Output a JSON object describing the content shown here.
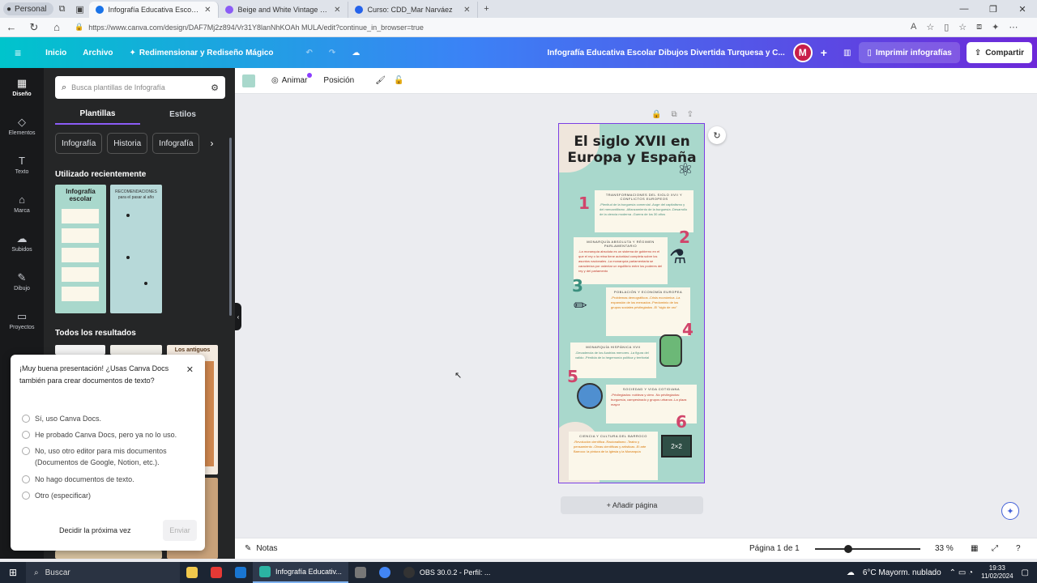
{
  "browser": {
    "profile": "Personal",
    "tabs": [
      {
        "title": "Infografía Educativa Escolar Dibuj...",
        "color": "#1a73e8"
      },
      {
        "title": "Beige and White Vintage Histori...",
        "color": "#8b5cf6"
      },
      {
        "title": "Curso: CDD_Mar Narváez",
        "color": "#2563eb"
      }
    ],
    "url": "https://www.canva.com/design/DAF7Mj2z894/Vr31Y8lanNhKOAh MULA/edit?continue_in_browser=true"
  },
  "header": {
    "home": "Inicio",
    "file": "Archivo",
    "resize": "Redimensionar y Rediseño Mágico",
    "doc_title": "Infografía Educativa Escolar Dibujos Divertida Turquesa y C...",
    "avatar": "M",
    "print": "Imprimir infografías",
    "share": "Compartir"
  },
  "rail": [
    {
      "label": "Diseño",
      "icon": "design-icon"
    },
    {
      "label": "Elementos",
      "icon": "elements-icon"
    },
    {
      "label": "Texto",
      "icon": "text-icon"
    },
    {
      "label": "Marca",
      "icon": "brand-icon"
    },
    {
      "label": "Subidos",
      "icon": "upload-icon"
    },
    {
      "label": "Dibujo",
      "icon": "draw-icon"
    },
    {
      "label": "Proyectos",
      "icon": "projects-icon"
    }
  ],
  "panel": {
    "search_placeholder": "Busca plantillas de Infografía",
    "tabs": [
      "Plantillas",
      "Estilos"
    ],
    "chips": [
      "Infografía",
      "Historia",
      "Infografía"
    ],
    "recent_title": "Utilizado recientemente",
    "all_title": "Todos los resultados",
    "thumb1_title": "Infografía escolar",
    "thumb2_title": "RECOMENDACIONES para el pasar al año",
    "thumb3_title": "Los antiguos"
  },
  "survey": {
    "question": "¡Muy buena presentación! ¿Usas Canva Docs también para crear documentos de texto?",
    "options": [
      "Sí, uso Canva Docs.",
      "He probado Canva Docs, pero ya no lo uso.",
      "No, uso otro editor para mis documentos (Documentos de Google, Notion, etc.).",
      "No hago documentos de texto.",
      "Otro (especificar)"
    ],
    "later": "Decidir la próxima vez",
    "send": "Enviar"
  },
  "toolbar": {
    "animate": "Animar",
    "position": "Posición"
  },
  "infographic": {
    "title": "El siglo XVII en Europa y España",
    "sections": [
      {
        "n": "1",
        "heading": "TRANSFORMACIONES DEL SIGLO XVII Y CONFLICTOS EUROPEOS",
        "lines": "-Plenitud de la burguesía comercial -Auge del capitalismo y del mercantilismo -Afianzamiento de la burguesía -Desarrollo de la ciencia moderna -Guerra de los 30 años"
      },
      {
        "n": "2",
        "heading": "MONARQUÍA ABSOLUTA Y RÉGIMEN PARLAMENTARIO",
        "lines": "-La monarquía absoluta es un sistema de gobierno en el que el rey o la reina tiene autoridad completa sobre los asuntos nacionales -La monarquía parlamentaria se caracteriza por ostentar un equilibrio entre los poderes del rey y del parlamento"
      },
      {
        "n": "3",
        "heading": "POBLACIÓN Y ECONOMÍA EUROPEA",
        "lines": "-Problemas demográficos -Crisis económica -La expansión de los mercados -Predominio de los grupos sociales privilegiados -El \"siglo de oro\""
      },
      {
        "n": "4",
        "heading": "MONARQUÍA HISPÁNICA XVII",
        "lines": "-Decadencia de los Austrias menores -La figura del valido -Pérdida de la hegemonía política y territorial"
      },
      {
        "n": "5",
        "heading": "SOCIEDAD Y VIDA COTIDIANA",
        "lines": "-Privilegiados: nobleza y clero -No privilegiados: burguesía, campesinado y grupos urbanos -La plaza mayor"
      },
      {
        "n": "6",
        "heading": "CIENCIA Y CULTURA DEL BARROCO",
        "lines": "-Revolución científica -Racionalismo -Teatro y pensamiento -Obras científicas y artísticas -El arte Barroco: la pintura de la Iglesia y la Monarquía"
      }
    ]
  },
  "canvas": {
    "add_page": "+ Añadir página"
  },
  "bottom": {
    "notes": "Notas",
    "page": "Página 1 de 1",
    "zoom": "33 %"
  },
  "taskbar": {
    "search": "Buscar",
    "apps": [
      "Infografía Educativ...",
      "OBS 30.0.2 - Perfil: ..."
    ],
    "weather": "6°C  Mayorm. nublado",
    "time": "19:33",
    "date": "11/02/2024"
  }
}
